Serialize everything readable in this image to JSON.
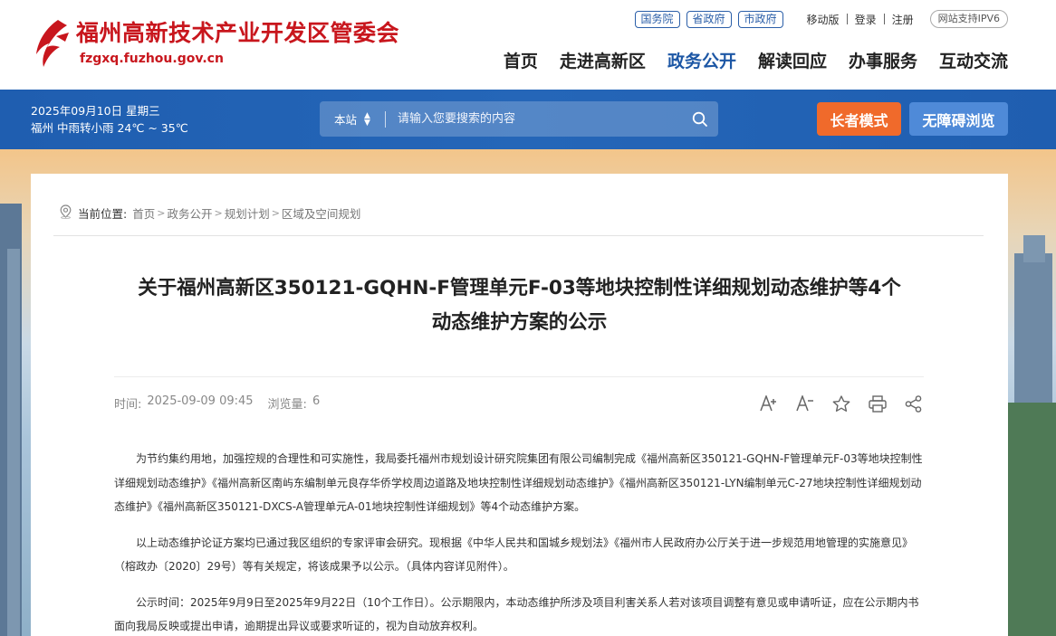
{
  "header": {
    "site_name": "福州高新技术产业开发区管委会",
    "site_url": "fzgxq.fuzhou.gov.cn",
    "gov_links": [
      "国务院",
      "省政府",
      "市政府"
    ],
    "mobile": "移动版",
    "login": "登录",
    "register": "注册",
    "ipv6": "网站支持IPV6",
    "nav": [
      "首页",
      "走进高新区",
      "政务公开",
      "解读回应",
      "办事服务",
      "互动交流"
    ],
    "nav_active_index": 2
  },
  "bar": {
    "date": "2025年09月10日 星期三",
    "weather": "福州 中雨转小雨 24℃ ~ 35℃",
    "search_scope": "本站",
    "search_placeholder": "请输入您要搜索的内容",
    "elder_mode": "长者模式",
    "accessible": "无障碍浏览"
  },
  "breadcrumb": {
    "label": "当前位置:",
    "items": [
      "首页",
      "政务公开",
      "规划计划",
      "区域及空间规划"
    ]
  },
  "article": {
    "title_line1": "关于福州高新区350121-GQHN-F管理单元F-03等地块控制性详细规划动态维护等4个",
    "title_line2": "动态维护方案的公示",
    "time_label": "时间:",
    "time_value": "2025-09-09 09:45",
    "views_label": "浏览量:",
    "views_value": "6",
    "paragraphs": [
      "为节约集约用地，加强控规的合理性和可实施性，我局委托福州市规划设计研究院集团有限公司编制完成《福州高新区350121-GQHN-F管理单元F-03等地块控制性详细规划动态维护》《福州高新区南屿东编制单元良存华侨学校周边道路及地块控制性详细规划动态维护》《福州高新区350121-LYN编制单元C-27地块控制性详细规划动态维护》《福州高新区350121-DXCS-A管理单元A-01地块控制性详细规划》等4个动态维护方案。",
      "以上动态维护论证方案均已通过我区组织的专家评审会研究。现根据《中华人民共和国城乡规划法》《福州市人民政府办公厅关于进一步规范用地管理的实施意见》（榕政办〔2020〕29号）等有关规定，将该成果予以公示。（具体内容详见附件）。",
      "公示时间：2025年9月9日至2025年9月22日（10个工作日）。公示期限内，本动态维护所涉及项目利害关系人若对该项目调整有意见或申请听证，应在公示期内书面向我局反映或提出申请，逾期提出异议或要求听证的，视为自动放弃权利。"
    ]
  },
  "colors": {
    "brand_red": "#c8161d",
    "nav_active": "#1d57a5",
    "bar_blue": "#2566b8",
    "elder_orange": "#f06a2b",
    "access_blue": "#4f8ad8"
  }
}
